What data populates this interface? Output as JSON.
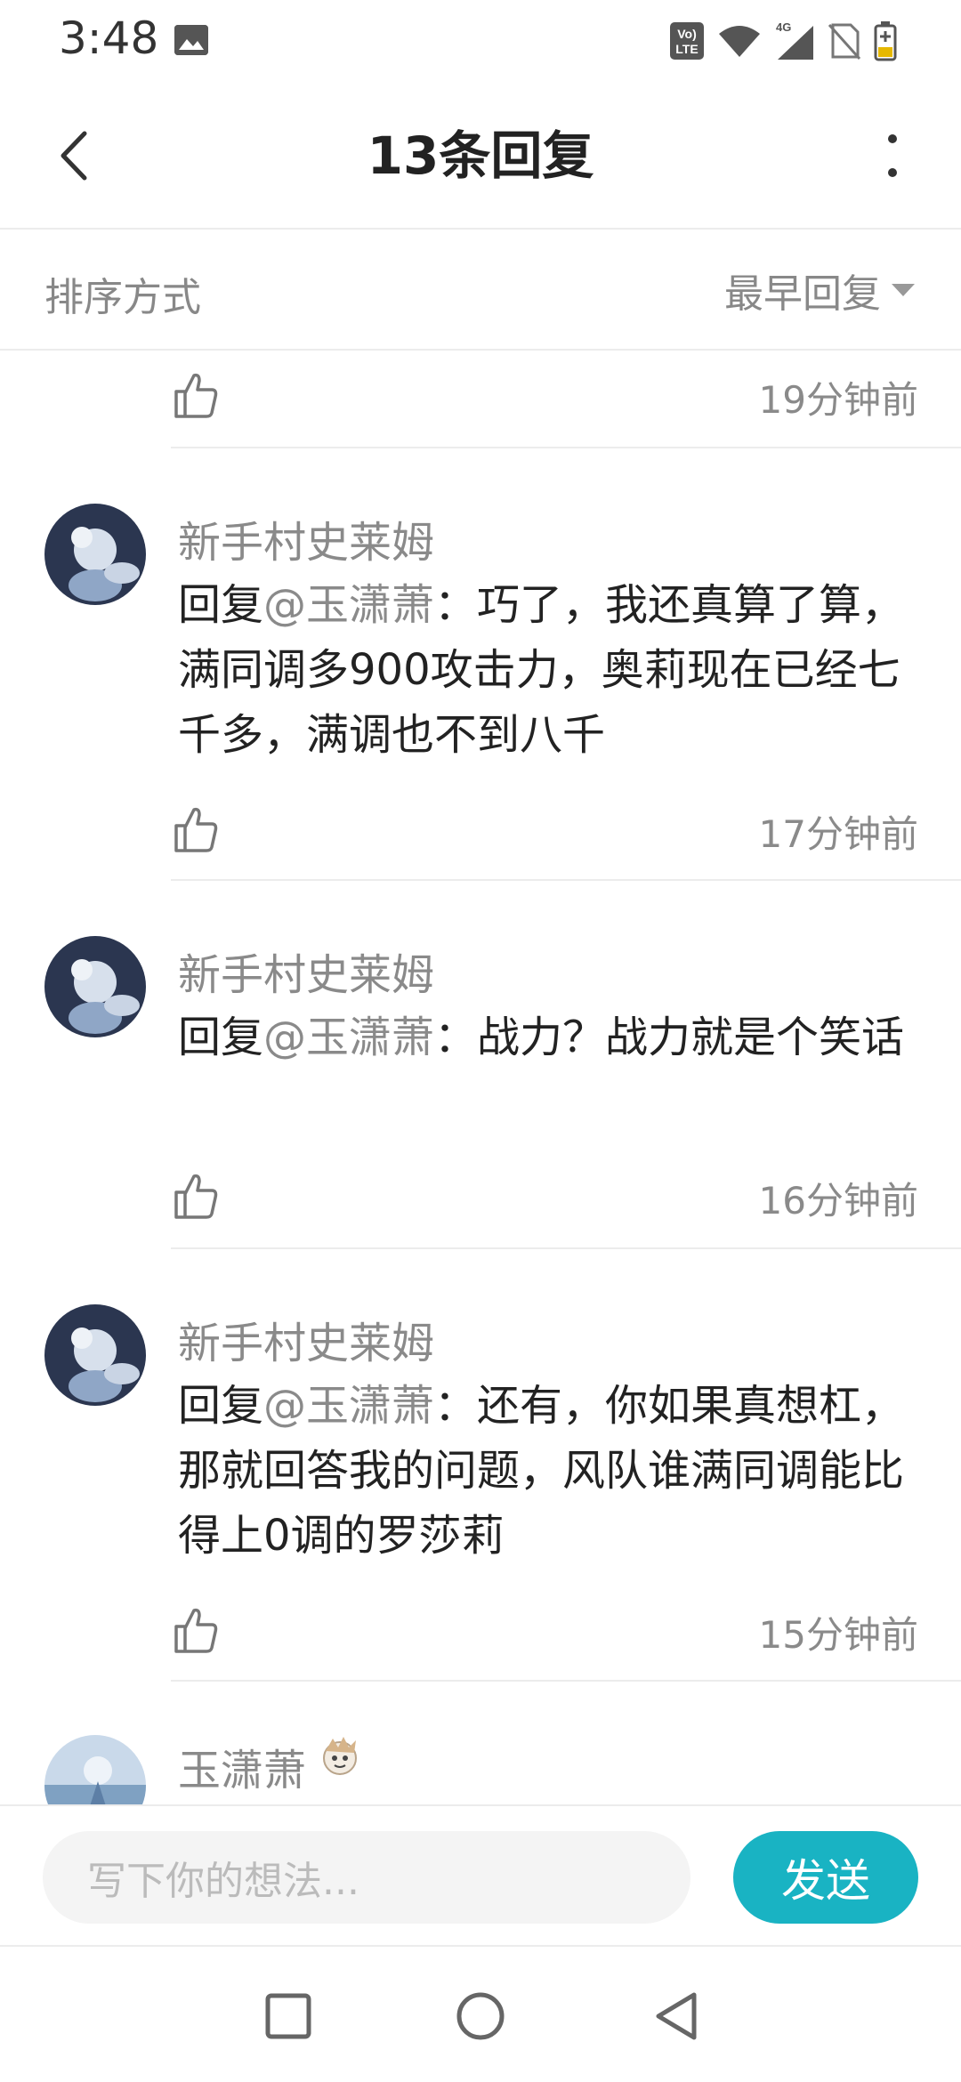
{
  "status_bar": {
    "time": "3:48",
    "icons": [
      "image-icon",
      "volte-icon",
      "wifi-icon",
      "4g-signal-icon",
      "no-sim-icon",
      "battery-charging-icon"
    ],
    "network_label": "4G",
    "volte_label_top": "Vo)",
    "volte_label_bottom": "LTE"
  },
  "header": {
    "title": "13条回复",
    "back_icon": "chevron-left-icon",
    "more_icon": "more-vertical-icon"
  },
  "sort": {
    "label": "排序方式",
    "value": "最早回复"
  },
  "comments": [
    {
      "time": "19分钟前"
    },
    {
      "name": "新手村史莱姆",
      "reply_prefix": "回复",
      "mention": "@玉潇萧",
      "text": "：巧了，我还真算了算，满同调多900攻击力，奥莉现在已经七千多，满调也不到八千",
      "time": "17分钟前"
    },
    {
      "name": "新手村史莱姆",
      "reply_prefix": "回复",
      "mention": "@玉潇萧",
      "text": "：战力？战力就是个笑话",
      "time": "16分钟前"
    },
    {
      "name": "新手村史莱姆",
      "reply_prefix": "回复",
      "mention": "@玉潇萧",
      "text": "：还有，你如果真想杠，那就回答我的问题，风队谁满同调能比得上0调的罗莎莉",
      "time": "15分钟前"
    },
    {
      "name": "玉潇萧"
    }
  ],
  "composer": {
    "placeholder": "写下你的想法...",
    "send_label": "发送"
  },
  "colors": {
    "accent": "#19b3c3",
    "muted_text": "#8a8a8a",
    "divider": "#ececec"
  }
}
